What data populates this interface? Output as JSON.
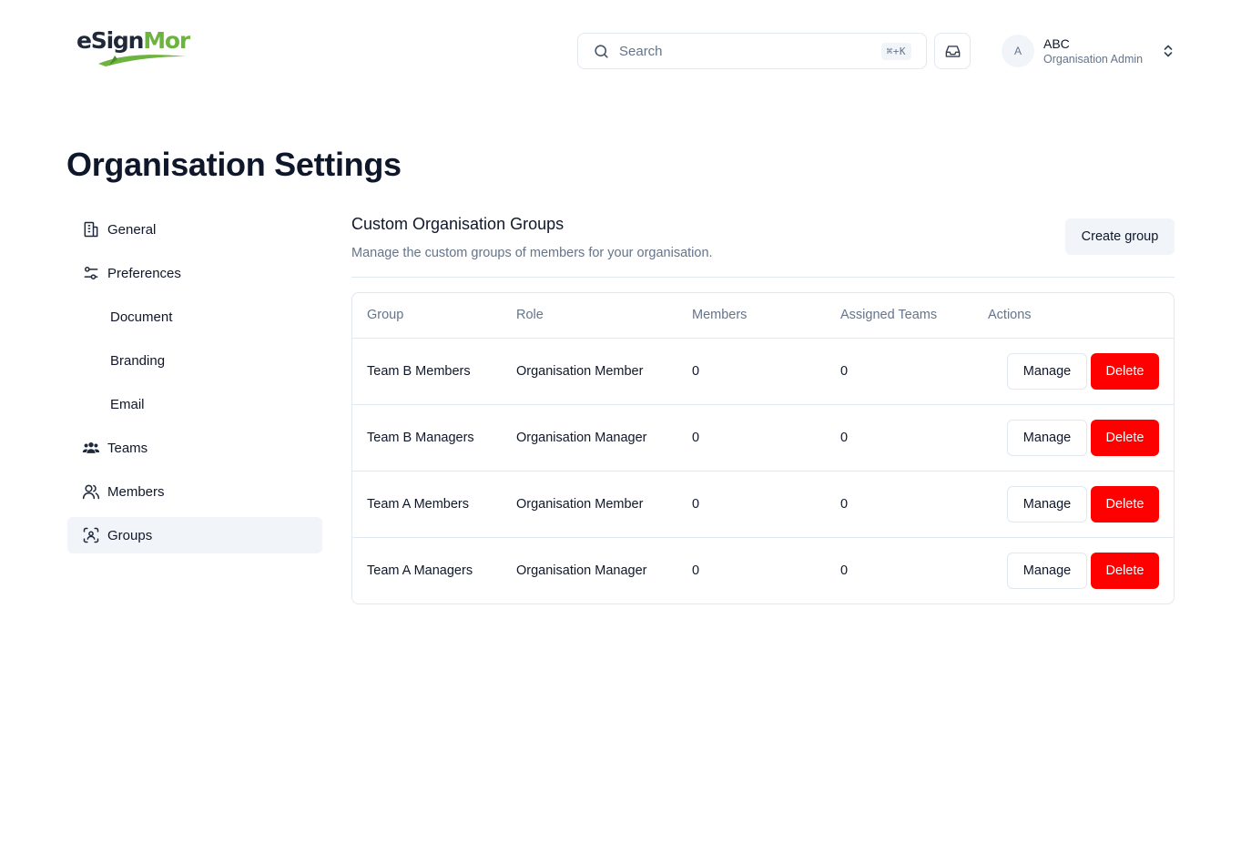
{
  "header": {
    "logo": {
      "part1": "eS",
      "part2": "ign",
      "part3": "Mor"
    },
    "search": {
      "placeholder": "Search",
      "shortcut": "⌘+K"
    },
    "user": {
      "avatar_initial": "A",
      "name": "ABC",
      "role": "Organisation Admin"
    }
  },
  "page": {
    "title": "Organisation Settings"
  },
  "sidebar": {
    "items": [
      {
        "label": "General",
        "icon": "building-icon"
      },
      {
        "label": "Preferences",
        "icon": "sliders-icon"
      },
      {
        "label": "Document",
        "icon": ""
      },
      {
        "label": "Branding",
        "icon": ""
      },
      {
        "label": "Email",
        "icon": ""
      },
      {
        "label": "Teams",
        "icon": "users-icon"
      },
      {
        "label": "Members",
        "icon": "user-icon"
      },
      {
        "label": "Groups",
        "icon": "group-scan-icon",
        "active": true
      }
    ]
  },
  "main": {
    "title": "Custom Organisation Groups",
    "description": "Manage the custom groups of members for your organisation.",
    "create_label": "Create group",
    "table": {
      "headers": [
        "Group",
        "Role",
        "Members",
        "Assigned Teams",
        "Actions"
      ],
      "rows": [
        {
          "group": "Team B Members",
          "role": "Organisation Member",
          "members": "0",
          "teams": "0"
        },
        {
          "group": "Team B Managers",
          "role": "Organisation Manager",
          "members": "0",
          "teams": "0"
        },
        {
          "group": "Team A Members",
          "role": "Organisation Member",
          "members": "0",
          "teams": "0"
        },
        {
          "group": "Team A Managers",
          "role": "Organisation Manager",
          "members": "0",
          "teams": "0"
        }
      ],
      "manage_label": "Manage",
      "delete_label": "Delete"
    }
  },
  "colors": {
    "delete": "#ff0000",
    "muted": "#64748b",
    "active_bg": "#f1f5f9",
    "logo_green": "#6db33f"
  }
}
